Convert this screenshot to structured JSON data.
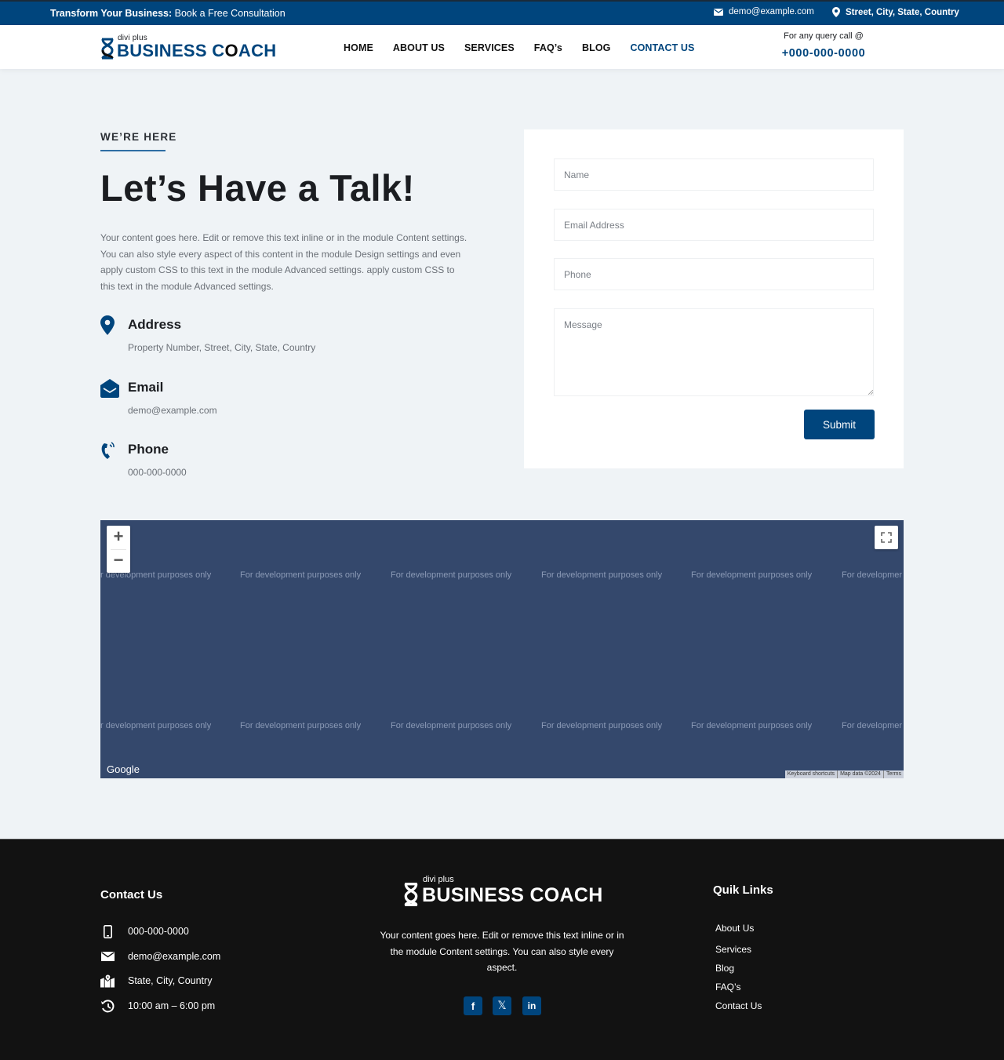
{
  "topbar": {
    "promo_bold": "Transform Your Business:",
    "promo_rest": " Book a Free Consultation",
    "email": "demo@example.com",
    "location": "Street, City, State, Country"
  },
  "header": {
    "logo_small": "divi plus",
    "logo_main": "BUSINESS C",
    "logo_o": "O",
    "logo_end": "ACH",
    "nav": [
      {
        "label": "HOME",
        "active": false
      },
      {
        "label": "ABOUT US",
        "active": false
      },
      {
        "label": "SERVICES",
        "active": false
      },
      {
        "label": "FAQ’s",
        "active": false
      },
      {
        "label": "BLOG",
        "active": false
      },
      {
        "label": "CONTACT US",
        "active": true
      }
    ],
    "query_label": "For any query call @",
    "query_phone": "+000-000-0000"
  },
  "contact": {
    "eyebrow": "WE’RE HERE",
    "title": "Let’s Have a Talk!",
    "intro": "Your content goes here. Edit or remove this text inline or in the module Content settings. You can also style every aspect of this content in the module Design settings and even apply custom CSS to this text in the module Advanced settings. apply custom CSS to this text in the module Advanced settings.",
    "items": [
      {
        "icon": "map-pin-icon",
        "heading": "Address",
        "value": "Property Number, Street, City, State, Country"
      },
      {
        "icon": "envelope-open-icon",
        "heading": "Email",
        "value": "demo@example.com"
      },
      {
        "icon": "phone-ringing-icon",
        "heading": "Phone",
        "value": "000-000-0000"
      }
    ]
  },
  "form": {
    "name_placeholder": "Name",
    "name_value": "",
    "email_placeholder": "Email Address",
    "email_value": "",
    "phone_placeholder": "Phone",
    "phone_value": "",
    "message_placeholder": "Message",
    "message_value": "",
    "submit_label": "Submit"
  },
  "map": {
    "watermark": "For development purposes only",
    "watermark_partial_left": "r development purposes only",
    "watermark_partial_right": "For developmer",
    "zoom_in": "+",
    "zoom_out": "−",
    "google_label": "Google",
    "attribution": [
      "Keyboard shortcuts",
      "Map data ©2024",
      "Terms"
    ]
  },
  "footer": {
    "contact_heading": "Contact Us",
    "contact_items": [
      {
        "icon": "mobile-phone-icon",
        "text": "000-000-0000"
      },
      {
        "icon": "envelope-icon",
        "text": "demo@example.com"
      },
      {
        "icon": "map-location-icon",
        "text": "State, City, Country"
      },
      {
        "icon": "clock-history-icon",
        "text": "10:00 am – 6:00 pm"
      }
    ],
    "logo_small": "divi plus",
    "logo_main": "BUSINESS COACH",
    "description": "Your content goes here. Edit or remove this text inline or in the module Content settings. You can also style every aspect.",
    "social": [
      {
        "icon": "facebook-icon",
        "glyph": "f"
      },
      {
        "icon": "x-twitter-icon",
        "glyph": "𝕏"
      },
      {
        "icon": "linkedin-icon",
        "glyph": "in"
      }
    ],
    "links_heading": "Quik Links",
    "links": [
      "About Us",
      "Services",
      "Blog",
      "FAQ’s",
      "Contact Us"
    ]
  },
  "colors": {
    "brand": "#00457d",
    "page_bg": "#eff3f6",
    "map_bg": "#34486c",
    "footer_bg": "#121212"
  }
}
